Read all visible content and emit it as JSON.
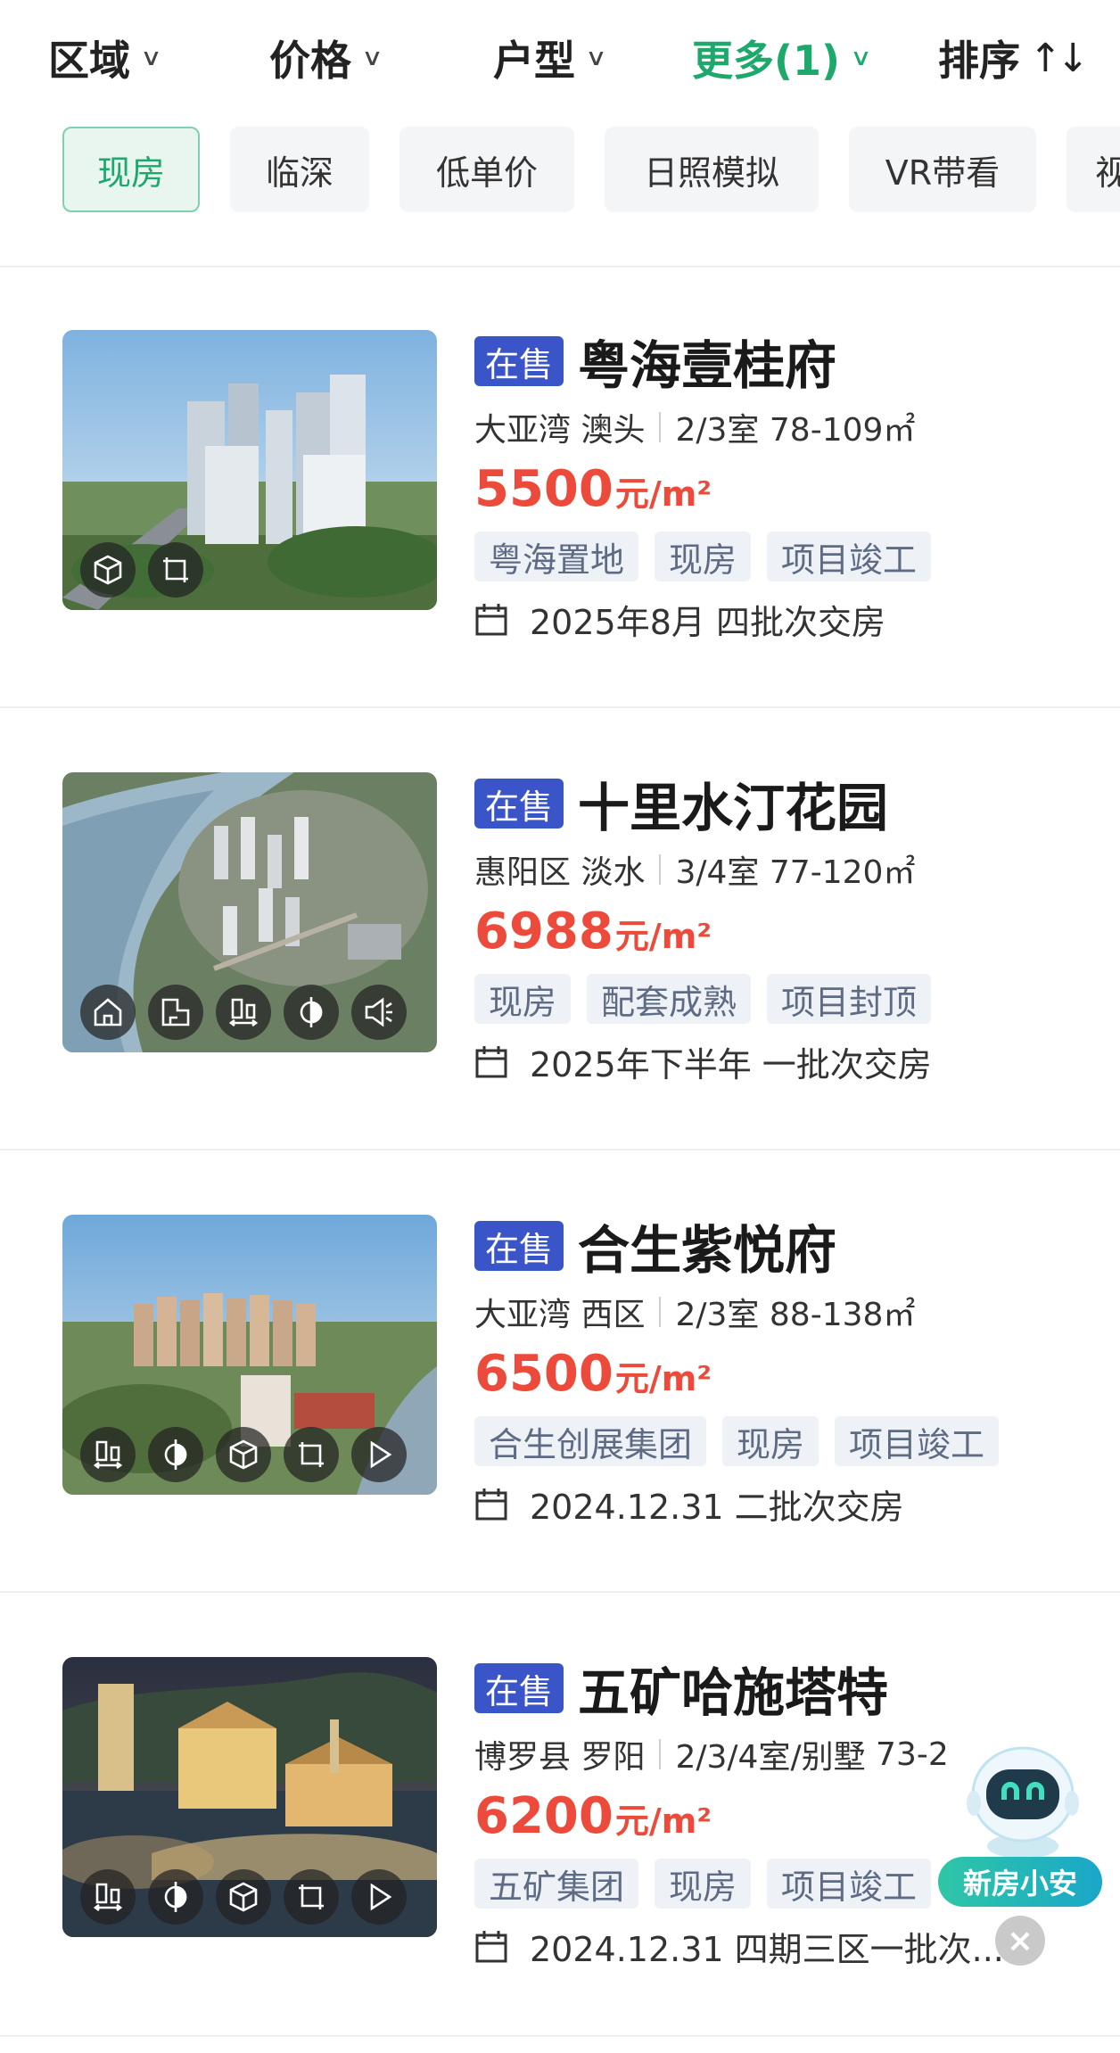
{
  "filters": [
    {
      "label": "区域",
      "icon": "chevron-down-icon"
    },
    {
      "label": "价格",
      "icon": "chevron-down-icon"
    },
    {
      "label": "户型",
      "icon": "chevron-down-icon"
    },
    {
      "label": "更多(1)",
      "icon": "chevron-down-icon",
      "active": true
    },
    {
      "label": "排序",
      "icon": "sort-icon"
    }
  ],
  "quick_tags": [
    {
      "label": "现房",
      "active": true
    },
    {
      "label": "临深"
    },
    {
      "label": "低单价"
    },
    {
      "label": "日照模拟"
    },
    {
      "label": "VR带看"
    },
    {
      "label": "视"
    }
  ],
  "listings": [
    {
      "status": "在售",
      "name": "粤海壹桂府",
      "district": "大亚湾",
      "area": "澳头",
      "layout": "2/3室",
      "size": "78-109㎡",
      "price": "5500",
      "price_unit": "元/m²",
      "tags": [
        "粤海置地",
        "现房",
        "项目竣工"
      ],
      "delivery": "2025年8月 四批次交房",
      "feature_icons": [
        "3d-model-icon",
        "floorplan-icon"
      ]
    },
    {
      "status": "在售",
      "name": "十里水汀花园",
      "district": "惠阳区",
      "area": "淡水",
      "layout": "3/4室",
      "size": "77-120㎡",
      "price": "6988",
      "price_unit": "元/m²",
      "tags": [
        "现房",
        "配套成熟",
        "项目封顶"
      ],
      "delivery": "2025年下半年 一批次交房",
      "feature_icons": [
        "home-icon",
        "house-type-icon",
        "building-distance-icon",
        "sunlight-icon",
        "audio-guide-icon"
      ]
    },
    {
      "status": "在售",
      "name": "合生紫悦府",
      "district": "大亚湾",
      "area": "西区",
      "layout": "2/3室",
      "size": "88-138㎡",
      "price": "6500",
      "price_unit": "元/m²",
      "tags": [
        "合生创展集团",
        "现房",
        "项目竣工"
      ],
      "delivery": "2024.12.31 二批次交房",
      "feature_icons": [
        "building-distance-icon",
        "sunlight-icon",
        "3d-model-icon",
        "floorplan-icon",
        "play-icon"
      ]
    },
    {
      "status": "在售",
      "name": "五矿哈施塔特",
      "district": "博罗县",
      "area": "罗阳",
      "layout": "2/3/4室/别墅",
      "size": "73-2",
      "price": "6200",
      "price_unit": "元/m²",
      "tags": [
        "五矿集团",
        "现房",
        "项目竣工"
      ],
      "delivery": "2024.12.31 四期三区一批次...",
      "feature_icons": [
        "building-distance-icon",
        "sunlight-icon",
        "3d-model-icon",
        "floorplan-icon",
        "play-icon"
      ]
    }
  ],
  "assistant": {
    "label": "新房小安",
    "close": "×"
  },
  "colors": {
    "accent": "#1fa86c",
    "price": "#ec4a3b",
    "status_badge": "#3a55c8",
    "tag_text": "#5d6c84"
  }
}
